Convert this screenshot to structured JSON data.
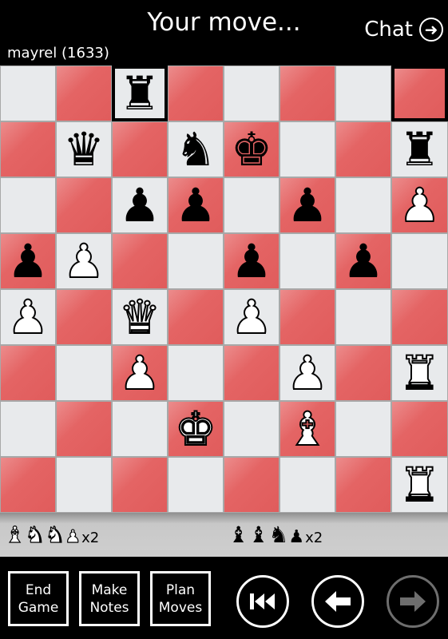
{
  "header": {
    "status": "Your move...",
    "chat_label": "Chat",
    "chat_icon": "arrow-right-circle-icon",
    "opponent": "mayrel (1633)"
  },
  "board": {
    "colors": {
      "light": "#e8eaec",
      "dark": "#e05c5c",
      "highlight_border": "#000000"
    },
    "last_move_squares": [
      [
        0,
        2
      ],
      [
        0,
        7
      ]
    ],
    "rows": [
      [
        "",
        "",
        "bR",
        "",
        "",
        "",
        "",
        ""
      ],
      [
        "",
        "bQ",
        "",
        "bN",
        "bK",
        "",
        "",
        "bR"
      ],
      [
        "",
        "",
        "bP",
        "bP",
        "",
        "bP",
        "",
        "wP"
      ],
      [
        "bP",
        "wP",
        "",
        "",
        "bP",
        "",
        "bP",
        ""
      ],
      [
        "wP",
        "",
        "wQ",
        "",
        "wP",
        "",
        "",
        ""
      ],
      [
        "",
        "",
        "wP",
        "",
        "",
        "wP",
        "",
        "wR"
      ],
      [
        "",
        "",
        "",
        "wK",
        "",
        "wB",
        "",
        ""
      ],
      [
        "",
        "",
        "",
        "",
        "",
        "",
        "",
        "wR"
      ]
    ]
  },
  "captured": {
    "white": {
      "pieces": [
        "wB",
        "wN",
        "wN",
        "wP"
      ],
      "count_label": "x2"
    },
    "black": {
      "pieces": [
        "bB",
        "bB",
        "bN",
        "bP"
      ],
      "count_label": "x2"
    }
  },
  "footer": {
    "end_game": [
      "End",
      "Game"
    ],
    "make_notes": [
      "Make",
      "Notes"
    ],
    "plan_moves": [
      "Plan",
      "Moves"
    ],
    "nav": {
      "first": {
        "icon": "rewind-to-start-icon",
        "enabled": true
      },
      "back": {
        "icon": "arrow-left-icon",
        "enabled": true
      },
      "forward": {
        "icon": "arrow-right-icon",
        "enabled": false
      }
    }
  }
}
